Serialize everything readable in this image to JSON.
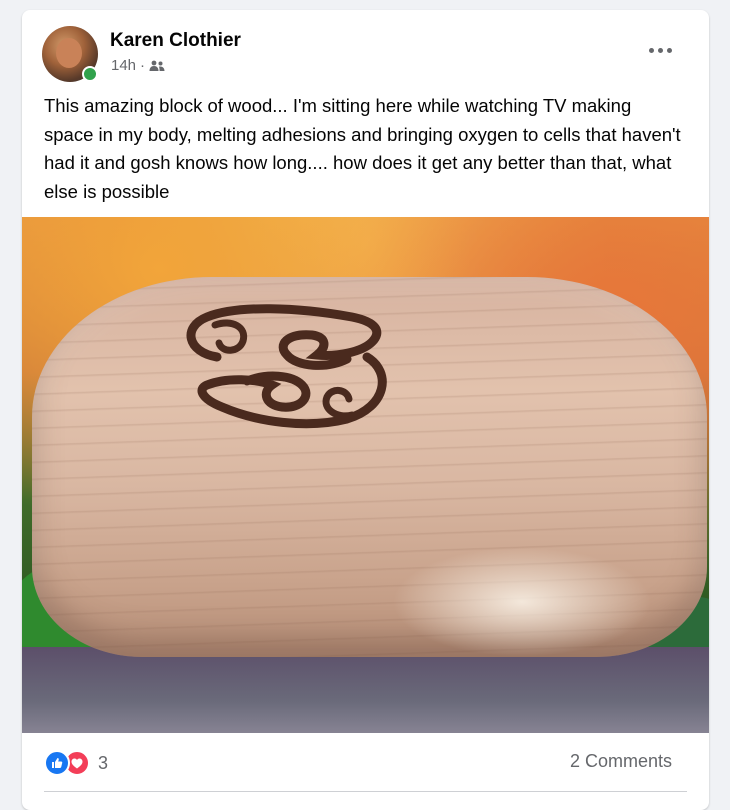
{
  "post": {
    "author": "Karen Clothier",
    "timestamp": "14h",
    "separator": "·",
    "audience_icon": "friends-icon",
    "online": true,
    "more_icon": "more-options-icon",
    "text": "This amazing block of wood... I'm sitting here while watching TV making space in my body,  melting adhesions and bringing oxygen to cells that haven't had it and gosh knows how long.... how does it get any better than that, what else is possible"
  },
  "reactions": {
    "icons": [
      "like-icon",
      "love-icon"
    ],
    "count": "3"
  },
  "comments": {
    "label": "2 Comments"
  },
  "colors": {
    "accent": "#1877f2",
    "love": "#f33e58",
    "online": "#31a24c",
    "secondary_text": "#65676b"
  }
}
